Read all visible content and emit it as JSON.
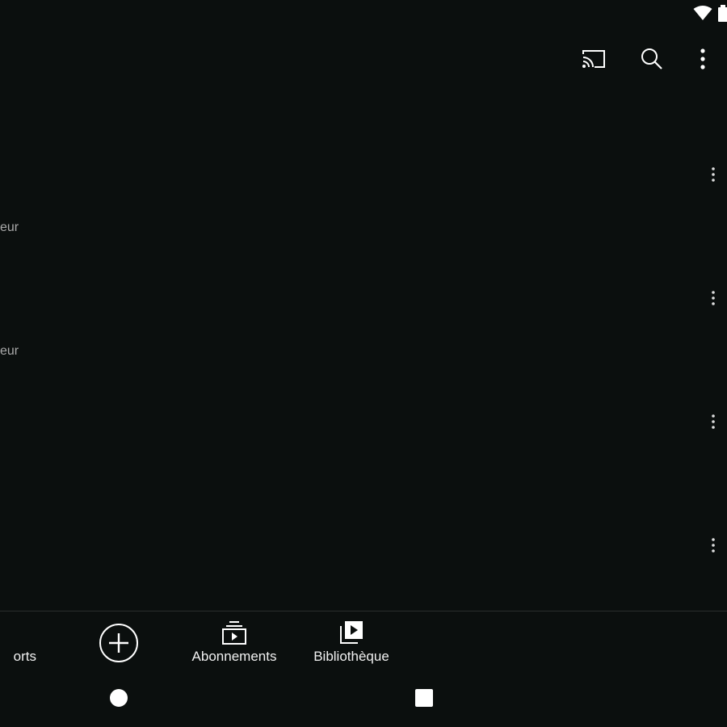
{
  "status_bar": {
    "icons": [
      "wifi-icon",
      "battery-icon"
    ]
  },
  "app_bar": {
    "actions": [
      {
        "name": "cast",
        "icon": "cast-icon"
      },
      {
        "name": "search",
        "icon": "search-icon"
      },
      {
        "name": "more",
        "icon": "more-vertical-icon"
      }
    ]
  },
  "feed": {
    "rows": [
      {
        "meta": "eur"
      },
      {
        "meta": "eur"
      },
      {
        "meta": ""
      },
      {
        "meta": ""
      }
    ]
  },
  "bottom_nav": {
    "shorts_label": "orts",
    "create_icon": "add-circle-icon",
    "subscriptions_label": "Abonnements",
    "library_label": "Bibliothèque"
  },
  "system_nav": {
    "buttons": [
      "home-button",
      "recents-button"
    ]
  },
  "colors": {
    "background": "#0b0f0e",
    "text": "#ffffff",
    "secondary_text": "#aaaaaa",
    "divider": "#2a2e2d"
  }
}
